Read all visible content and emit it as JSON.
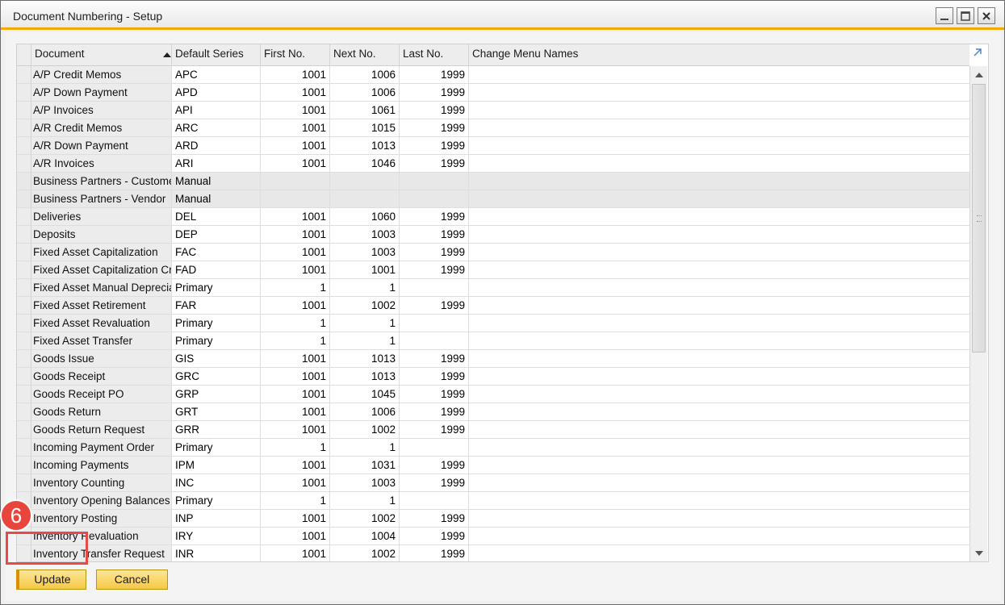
{
  "window": {
    "title": "Document Numbering - Setup",
    "controls": [
      "minimize",
      "maximize",
      "close"
    ]
  },
  "grid": {
    "columns": {
      "document": "Document",
      "default_series": "Default Series",
      "first_no": "First No.",
      "next_no": "Next No.",
      "last_no": "Last No.",
      "change_menu_names": "Change Menu Names"
    },
    "sort": {
      "column": "Document",
      "direction": "ascending"
    },
    "rows": [
      {
        "document": "A/P Credit Memos",
        "series": "APC",
        "first": "1001",
        "next": "1006",
        "last": "1999",
        "menu": "",
        "manual": false
      },
      {
        "document": "A/P Down Payment",
        "series": "APD",
        "first": "1001",
        "next": "1006",
        "last": "1999",
        "menu": "",
        "manual": false
      },
      {
        "document": "A/P Invoices",
        "series": "API",
        "first": "1001",
        "next": "1061",
        "last": "1999",
        "menu": "",
        "manual": false
      },
      {
        "document": "A/R Credit Memos",
        "series": "ARC",
        "first": "1001",
        "next": "1015",
        "last": "1999",
        "menu": "",
        "manual": false
      },
      {
        "document": "A/R Down Payment",
        "series": "ARD",
        "first": "1001",
        "next": "1013",
        "last": "1999",
        "menu": "",
        "manual": false
      },
      {
        "document": "A/R Invoices",
        "series": "ARI",
        "first": "1001",
        "next": "1046",
        "last": "1999",
        "menu": "",
        "manual": false
      },
      {
        "document": "Business Partners - Custome",
        "series": "Manual",
        "first": "",
        "next": "",
        "last": "",
        "menu": "",
        "manual": true
      },
      {
        "document": "Business Partners - Vendor",
        "series": "Manual",
        "first": "",
        "next": "",
        "last": "",
        "menu": "",
        "manual": true
      },
      {
        "document": "Deliveries",
        "series": "DEL",
        "first": "1001",
        "next": "1060",
        "last": "1999",
        "menu": "",
        "manual": false
      },
      {
        "document": "Deposits",
        "series": "DEP",
        "first": "1001",
        "next": "1003",
        "last": "1999",
        "menu": "",
        "manual": false
      },
      {
        "document": "Fixed Asset Capitalization",
        "series": "FAC",
        "first": "1001",
        "next": "1003",
        "last": "1999",
        "menu": "",
        "manual": false
      },
      {
        "document": "Fixed Asset Capitalization Cre",
        "series": "FAD",
        "first": "1001",
        "next": "1001",
        "last": "1999",
        "menu": "",
        "manual": false
      },
      {
        "document": "Fixed Asset Manual Deprecia",
        "series": "Primary",
        "first": "1",
        "next": "1",
        "last": "",
        "menu": "",
        "manual": false
      },
      {
        "document": "Fixed Asset Retirement",
        "series": "FAR",
        "first": "1001",
        "next": "1002",
        "last": "1999",
        "menu": "",
        "manual": false
      },
      {
        "document": "Fixed Asset Revaluation",
        "series": "Primary",
        "first": "1",
        "next": "1",
        "last": "",
        "menu": "",
        "manual": false
      },
      {
        "document": "Fixed Asset Transfer",
        "series": "Primary",
        "first": "1",
        "next": "1",
        "last": "",
        "menu": "",
        "manual": false
      },
      {
        "document": "Goods Issue",
        "series": "GIS",
        "first": "1001",
        "next": "1013",
        "last": "1999",
        "menu": "",
        "manual": false
      },
      {
        "document": "Goods Receipt",
        "series": "GRC",
        "first": "1001",
        "next": "1013",
        "last": "1999",
        "menu": "",
        "manual": false
      },
      {
        "document": "Goods Receipt PO",
        "series": "GRP",
        "first": "1001",
        "next": "1045",
        "last": "1999",
        "menu": "",
        "manual": false
      },
      {
        "document": "Goods Return",
        "series": "GRT",
        "first": "1001",
        "next": "1006",
        "last": "1999",
        "menu": "",
        "manual": false
      },
      {
        "document": "Goods Return Request",
        "series": "GRR",
        "first": "1001",
        "next": "1002",
        "last": "1999",
        "menu": "",
        "manual": false
      },
      {
        "document": "Incoming Payment Order",
        "series": "Primary",
        "first": "1",
        "next": "1",
        "last": "",
        "menu": "",
        "manual": false
      },
      {
        "document": "Incoming Payments",
        "series": "IPM",
        "first": "1001",
        "next": "1031",
        "last": "1999",
        "menu": "",
        "manual": false
      },
      {
        "document": "Inventory Counting",
        "series": "INC",
        "first": "1001",
        "next": "1003",
        "last": "1999",
        "menu": "",
        "manual": false
      },
      {
        "document": "Inventory Opening Balances",
        "series": "Primary",
        "first": "1",
        "next": "1",
        "last": "",
        "menu": "",
        "manual": false
      },
      {
        "document": "Inventory Posting",
        "series": "INP",
        "first": "1001",
        "next": "1002",
        "last": "1999",
        "menu": "",
        "manual": false
      },
      {
        "document": "Inventory Revaluation",
        "series": "IRY",
        "first": "1001",
        "next": "1004",
        "last": "1999",
        "menu": "",
        "manual": false
      },
      {
        "document": "Inventory Transfer Request",
        "series": "INR",
        "first": "1001",
        "next": "1002",
        "last": "1999",
        "menu": "",
        "manual": false
      }
    ]
  },
  "buttons": {
    "update": "Update",
    "cancel": "Cancel"
  },
  "annotation": {
    "step_number": "6",
    "highlight_color": "#e84a4a"
  },
  "colors": {
    "accent": "#f0ab00",
    "button": "#f6c843"
  }
}
